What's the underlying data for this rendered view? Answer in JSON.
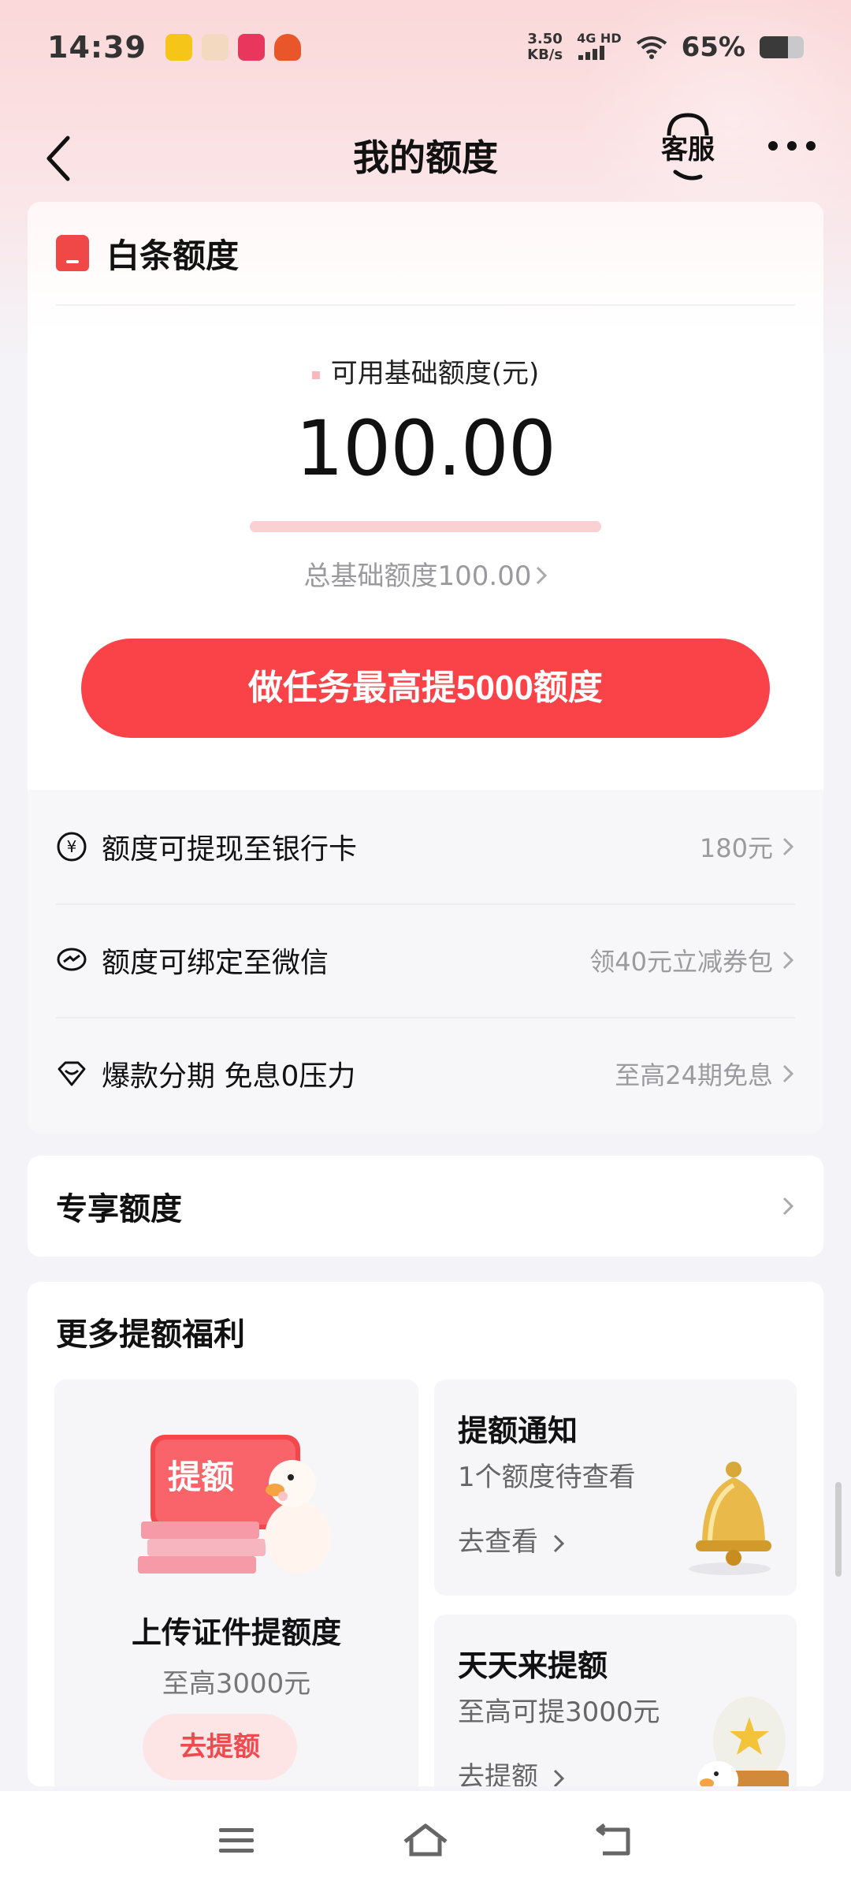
{
  "status_bar": {
    "time": "14:39",
    "net_speed_value": "3.50",
    "net_speed_unit": "KB/s",
    "signal_label": "4G HD",
    "battery_percent": "65%",
    "battery_level": 0.65
  },
  "header": {
    "title": "我的额度",
    "service_label": "客服"
  },
  "baitiao": {
    "title": "白条额度",
    "available_label": "可用基础额度(元)",
    "available_amount": "100.00",
    "total_label": "总基础额度100.00",
    "task_button": "做任务最高提5000额度",
    "progress_level": 1.0
  },
  "features": [
    {
      "label": "额度可提现至银行卡",
      "value": "180元",
      "icon": "yuan-circle-icon"
    },
    {
      "label": "额度可绑定至微信",
      "value": "领40元立减券包",
      "icon": "wechat-icon"
    },
    {
      "label": "爆款分期 免息0压力",
      "value": "至高24期免息",
      "icon": "heart-shield-icon"
    }
  ],
  "exclusive": {
    "title": "专享额度"
  },
  "more_benefits": {
    "title": "更多提额福利",
    "upload": {
      "illustration_text": "提额",
      "title": "上传证件提额度",
      "subtitle": "至高3000元",
      "button": "去提额"
    },
    "notify": {
      "title": "提额通知",
      "subtitle": "1个额度待查看",
      "link": "去查看"
    },
    "daily": {
      "title": "天天来提额",
      "subtitle": "至高可提3000元",
      "link": "去提额"
    }
  },
  "colors": {
    "primary_red": "#f94348",
    "header_gradient_top": "#fbd8d9",
    "muted_text": "#9b9b9f"
  }
}
